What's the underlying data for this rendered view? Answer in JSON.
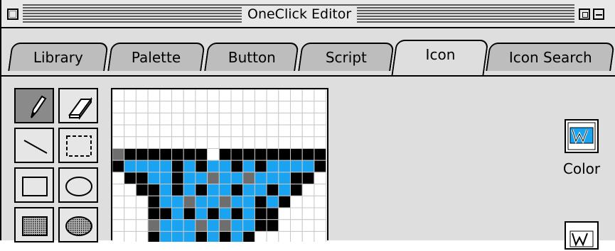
{
  "window": {
    "title": "OneClick Editor"
  },
  "tabs": [
    {
      "label": "Library",
      "active": false
    },
    {
      "label": "Palette",
      "active": false
    },
    {
      "label": "Button",
      "active": false
    },
    {
      "label": "Script",
      "active": false
    },
    {
      "label": "Icon",
      "active": true
    },
    {
      "label": "Icon Search",
      "active": false
    }
  ],
  "tools": [
    {
      "icon": "pencil-icon",
      "selected": true
    },
    {
      "icon": "eraser-icon",
      "selected": false
    },
    {
      "icon": "line-icon",
      "selected": false
    },
    {
      "icon": "marquee-select-icon",
      "selected": false
    },
    {
      "icon": "rectangle-icon",
      "selected": false
    },
    {
      "icon": "oval-icon",
      "selected": false
    },
    {
      "icon": "filled-rectangle-icon",
      "selected": false
    },
    {
      "icon": "filled-oval-icon",
      "selected": false
    }
  ],
  "preview": {
    "color_label": "Color",
    "icon": "w-app-icon"
  },
  "colors": {
    "black": "#000000",
    "blue": "#1aa3f0",
    "gray": "#6e6e6e",
    "white": "#ffffff",
    "grid": "#c8c8c8"
  },
  "pixel_grid": {
    "cols": 18,
    "rows": [
      "..................",
      "..................",
      "..................",
      "..................",
      "..................",
      "gKKKKKKK.KKKKKKKKK",
      "KBBBBKBKBBKBKBBBBK",
      ".KKBBKBBGBBGBBBKK.",
      "..KKBKBKBBKBBKBK..",
      "...KBBGBBGBBKBK...",
      "...KKBKBKBKBKK....",
      "...GBBBGBGBBKK....",
      "...KBBBKBKBK......",
      "..................."
    ]
  }
}
